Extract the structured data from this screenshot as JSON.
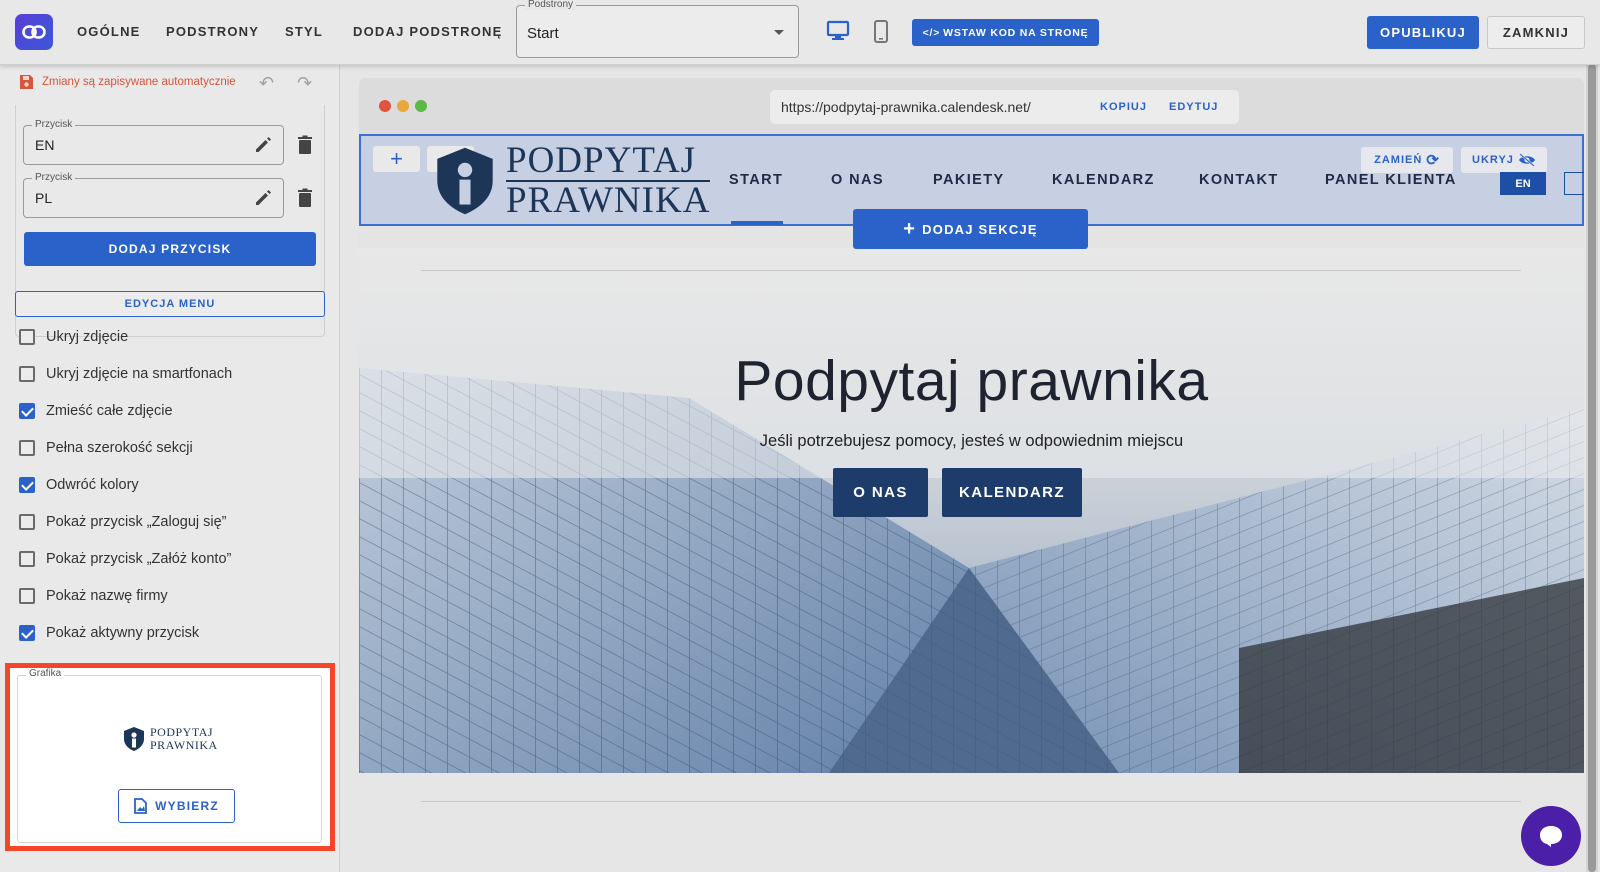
{
  "topbar": {
    "nav": [
      "OGÓLNE",
      "PODSTRONY",
      "STYL",
      "DODAJ PODSTRONĘ"
    ],
    "subpages_legend": "Podstrony",
    "subpages_value": "Start",
    "embed_label": "WSTAW KOD NA STRONĘ",
    "publish_label": "OPUBLIKUJ",
    "close_label": "ZAMKNIJ"
  },
  "sidebar": {
    "autosave_text": "Zmiany są zapisywane automatycznie",
    "buttons": [
      {
        "legend": "Przycisk",
        "value": "EN"
      },
      {
        "legend": "Przycisk",
        "value": "PL"
      }
    ],
    "add_button_label": "DODAJ PRZYCISK",
    "menu_edit_label": "EDYCJA MENU",
    "options": [
      {
        "label": "Ukryj zdjęcie",
        "checked": false
      },
      {
        "label": "Ukryj zdjęcie na smartfonach",
        "checked": false
      },
      {
        "label": "Zmieść całe zdjęcie",
        "checked": true
      },
      {
        "label": "Pełna szerokość sekcji",
        "checked": false
      },
      {
        "label": "Odwróć kolory",
        "checked": true
      },
      {
        "label": "Pokaż przycisk „Zaloguj się”",
        "checked": false
      },
      {
        "label": "Pokaż przycisk „Załóż konto”",
        "checked": false
      },
      {
        "label": "Pokaż nazwę firmy",
        "checked": false
      },
      {
        "label": "Pokaż aktywny przycisk",
        "checked": true
      }
    ],
    "graphic_legend": "Grafika",
    "graphic_logo_line1": "PODPYTAJ",
    "graphic_logo_line2": "PRAWNIKA",
    "choose_label": "WYBIERZ"
  },
  "preview": {
    "url": "https://podpytaj-prawnika.calendesk.net/",
    "copy_label": "KOPIUJ",
    "edit_label": "EDYTUJ",
    "logo_line1": "PODPYTAJ",
    "logo_line2": "PRAWNIKA",
    "nav": [
      "START",
      "O NAS",
      "PAKIETY",
      "KALENDARZ",
      "KONTAKT",
      "PANEL KLIENTA"
    ],
    "lang": "EN",
    "swap_label": "ZAMIEŃ",
    "hide_label": "UKRYJ",
    "add_section_label": "DODAJ SEKCJĘ",
    "hero_title": "Podpytaj prawnika",
    "hero_subtitle": "Jeśli potrzebujesz pomocy, jesteś w odpowiednim miejscu",
    "hero_buttons": [
      "O NAS",
      "KALENDARZ"
    ]
  },
  "colors": {
    "accent": "#2b62c9",
    "highlight_border": "#f4472a",
    "navy": "#1d3c6b",
    "chat": "#4b1fa8"
  }
}
